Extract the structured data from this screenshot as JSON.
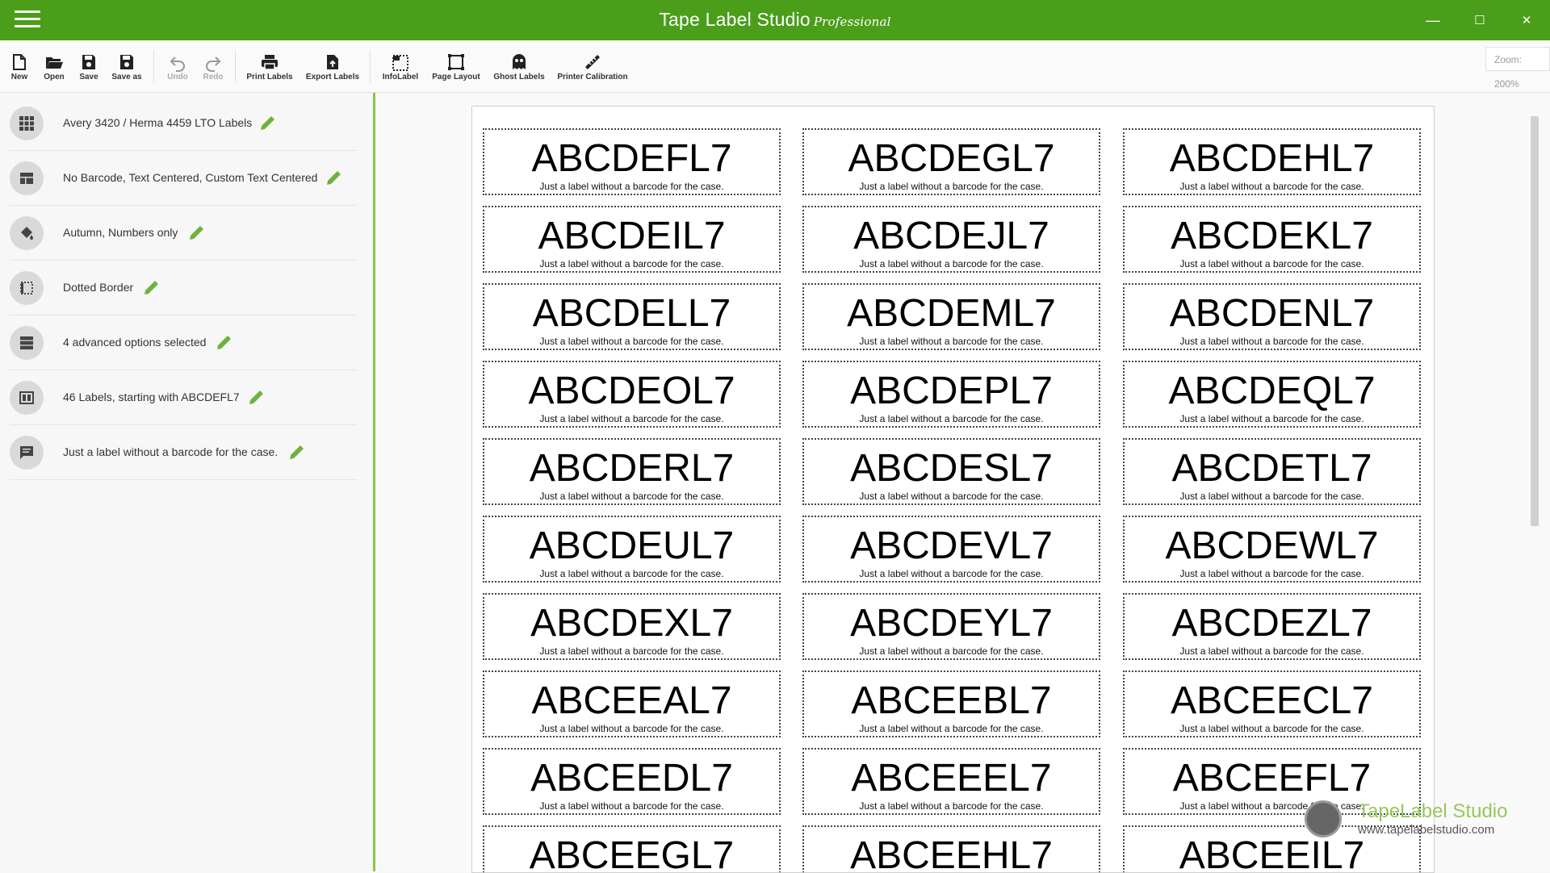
{
  "window": {
    "title": "Tape Label Studio",
    "edition": "Professional",
    "minimize": "—",
    "maximize": "☐",
    "close": "✕"
  },
  "toolbar": {
    "items": [
      {
        "label": "New",
        "icon": "new-file-icon"
      },
      {
        "label": "Open",
        "icon": "folder-open-icon"
      },
      {
        "label": "Save",
        "icon": "save-icon"
      },
      {
        "label": "Save as",
        "icon": "save-as-icon"
      },
      {
        "label": "Undo",
        "icon": "undo-icon",
        "disabled": true
      },
      {
        "label": "Redo",
        "icon": "redo-icon",
        "disabled": true
      },
      {
        "label": "Print Labels",
        "icon": "printer-icon"
      },
      {
        "label": "Export Labels",
        "icon": "export-icon"
      },
      {
        "label": "InfoLabel",
        "icon": "info-label-icon"
      },
      {
        "label": "Page Layout",
        "icon": "page-layout-icon"
      },
      {
        "label": "Ghost Labels",
        "icon": "ghost-icon"
      },
      {
        "label": "Printer Calibration",
        "icon": "ruler-icon"
      }
    ],
    "zoom": "Zoom: 200%"
  },
  "sidebar": {
    "items": [
      {
        "label": "Avery 3420 / Herma 4459 LTO Labels",
        "icon": "grid-icon"
      },
      {
        "label": "No Barcode, Text Centered, Custom Text Centered",
        "icon": "layout-icon"
      },
      {
        "label": "Autumn, Numbers only",
        "icon": "paint-bucket-icon"
      },
      {
        "label": "Dotted Border",
        "icon": "border-icon"
      },
      {
        "label": "4 advanced options selected",
        "icon": "server-icon"
      },
      {
        "label": "46 Labels, starting with ABCDEFL7",
        "icon": "numbers-icon"
      },
      {
        "label": "Just a label without a barcode for the case.",
        "icon": "comment-icon"
      }
    ]
  },
  "labels": {
    "description": "Just a label without a barcode for the case.",
    "codes": [
      "ABCDEFL7",
      "ABCDEGL7",
      "ABCDEHL7",
      "ABCDEIL7",
      "ABCDEJL7",
      "ABCDEKL7",
      "ABCDELL7",
      "ABCDEML7",
      "ABCDENL7",
      "ABCDEOL7",
      "ABCDEPL7",
      "ABCDEQL7",
      "ABCDERL7",
      "ABCDESL7",
      "ABCDETL7",
      "ABCDEUL7",
      "ABCDEVL7",
      "ABCDEWL7",
      "ABCDEXL7",
      "ABCDEYL7",
      "ABCDEZL7",
      "ABCEEAL7",
      "ABCEEBL7",
      "ABCEECL7",
      "ABCEEDL7",
      "ABCEEEL7",
      "ABCEEFL7",
      "ABCEEGL7",
      "ABCEEHL7",
      "ABCEEIL7"
    ]
  },
  "watermark": {
    "title": "TapeLabel Studio",
    "url": "www.tapelabelstudio.com"
  },
  "colors": {
    "brand": "#4a9e1a",
    "accent": "#8bc34a"
  }
}
